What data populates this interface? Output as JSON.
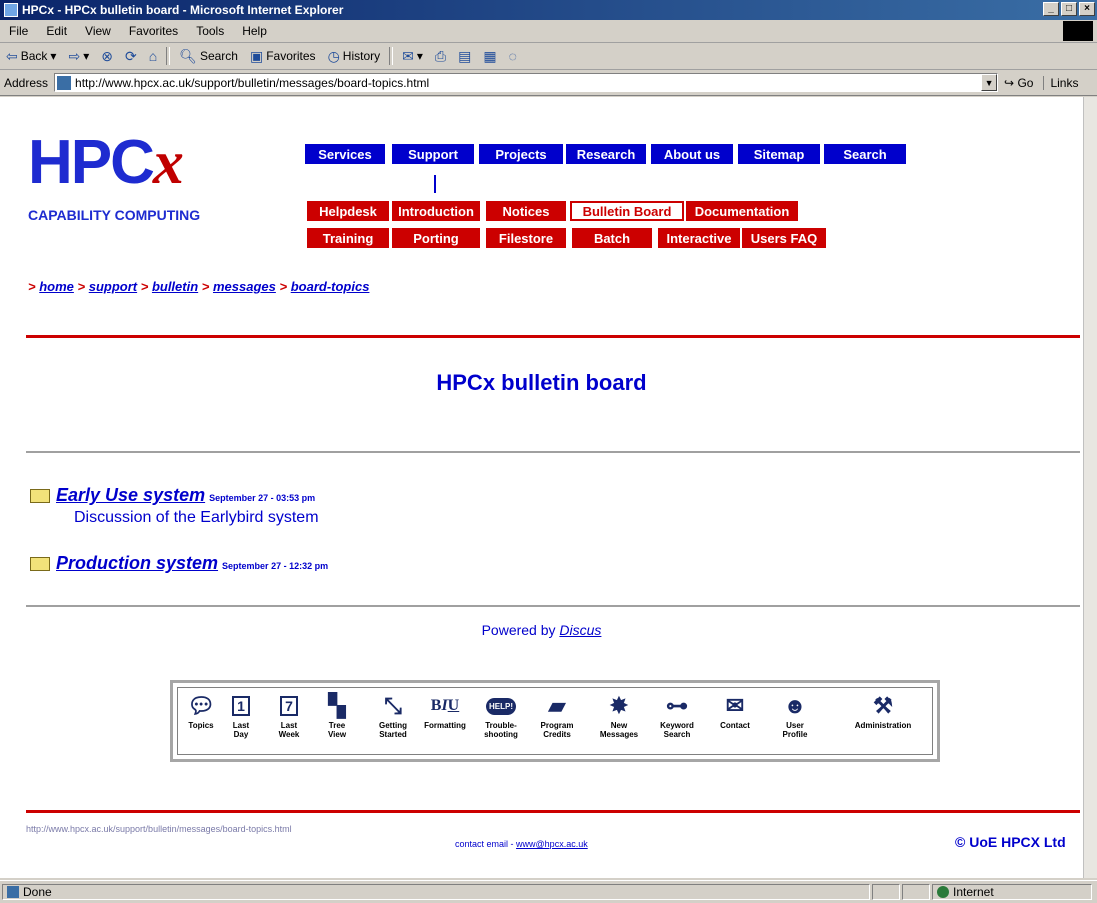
{
  "window": {
    "title": "HPCx - HPCx bulletin board - Microsoft Internet Explorer"
  },
  "menu": [
    "File",
    "Edit",
    "View",
    "Favorites",
    "Tools",
    "Help"
  ],
  "toolbar": {
    "back": "Back",
    "forward": "⇨",
    "search": "Search",
    "favorites": "Favorites",
    "history": "History"
  },
  "address": {
    "label": "Address",
    "url": "http://www.hpcx.ac.uk/support/bulletin/messages/board-topics.html",
    "go": "Go",
    "links": "Links"
  },
  "logo": {
    "text_main": "HPC",
    "text_x": "x",
    "subtitle": "CAPABILITY COMPUTING"
  },
  "nav": {
    "top": [
      "Services",
      "Support",
      "Projects",
      "Research",
      "About us",
      "Sitemap",
      "Search"
    ],
    "sub1": [
      "Helpdesk",
      "Introduction",
      "Notices",
      "Bulletin Board",
      "Documentation"
    ],
    "sub2": [
      "Training",
      "Porting",
      "Filestore",
      "Batch",
      "Interactive",
      "Users FAQ"
    ]
  },
  "breadcrumb": [
    "home",
    "support",
    "bulletin",
    "messages",
    "board-topics"
  ],
  "page_title": "HPCx bulletin board",
  "topics": [
    {
      "title": "Early Use system",
      "date": "September 27 - 03:53 pm",
      "description": "Discussion of the Earlybird system"
    },
    {
      "title": "Production system",
      "date": "September 27 - 12:32 pm",
      "description": ""
    }
  ],
  "powered": {
    "prefix": "Powered by",
    "link": "Discus"
  },
  "discus_toolbar": [
    {
      "icon": "topics-icon",
      "l1": "Topics",
      "l2": ""
    },
    {
      "icon": "calendar-1-icon",
      "l1": "Last",
      "l2": "Day"
    },
    {
      "icon": "calendar-7-icon",
      "l1": "Last",
      "l2": "Week"
    },
    {
      "icon": "tree-icon",
      "l1": "Tree",
      "l2": "View"
    },
    {
      "icon": "arrows-icon",
      "l1": "Getting",
      "l2": "Started"
    },
    {
      "icon": "formatting-icon",
      "l1": "Formatting",
      "l2": ""
    },
    {
      "icon": "help-icon",
      "l1": "Trouble-",
      "l2": "shooting"
    },
    {
      "icon": "clapper-icon",
      "l1": "Program",
      "l2": "Credits"
    },
    {
      "icon": "splat-icon",
      "l1": "New",
      "l2": "Messages"
    },
    {
      "icon": "key-icon",
      "l1": "Keyword",
      "l2": "Search"
    },
    {
      "icon": "envelope-icon",
      "l1": "Contact",
      "l2": ""
    },
    {
      "icon": "head-icon",
      "l1": "User",
      "l2": "Profile"
    },
    {
      "icon": "tools-icon",
      "l1": "Administration",
      "l2": ""
    }
  ],
  "footer": {
    "url": "http://www.hpcx.ac.uk/support/bulletin/messages/board-topics.html",
    "contact_prefix": "contact email -",
    "contact_email": "www@hpcx.ac.uk",
    "copyright": "© UoE HPCX Ltd"
  },
  "status": {
    "text": "Done",
    "zone": "Internet"
  }
}
